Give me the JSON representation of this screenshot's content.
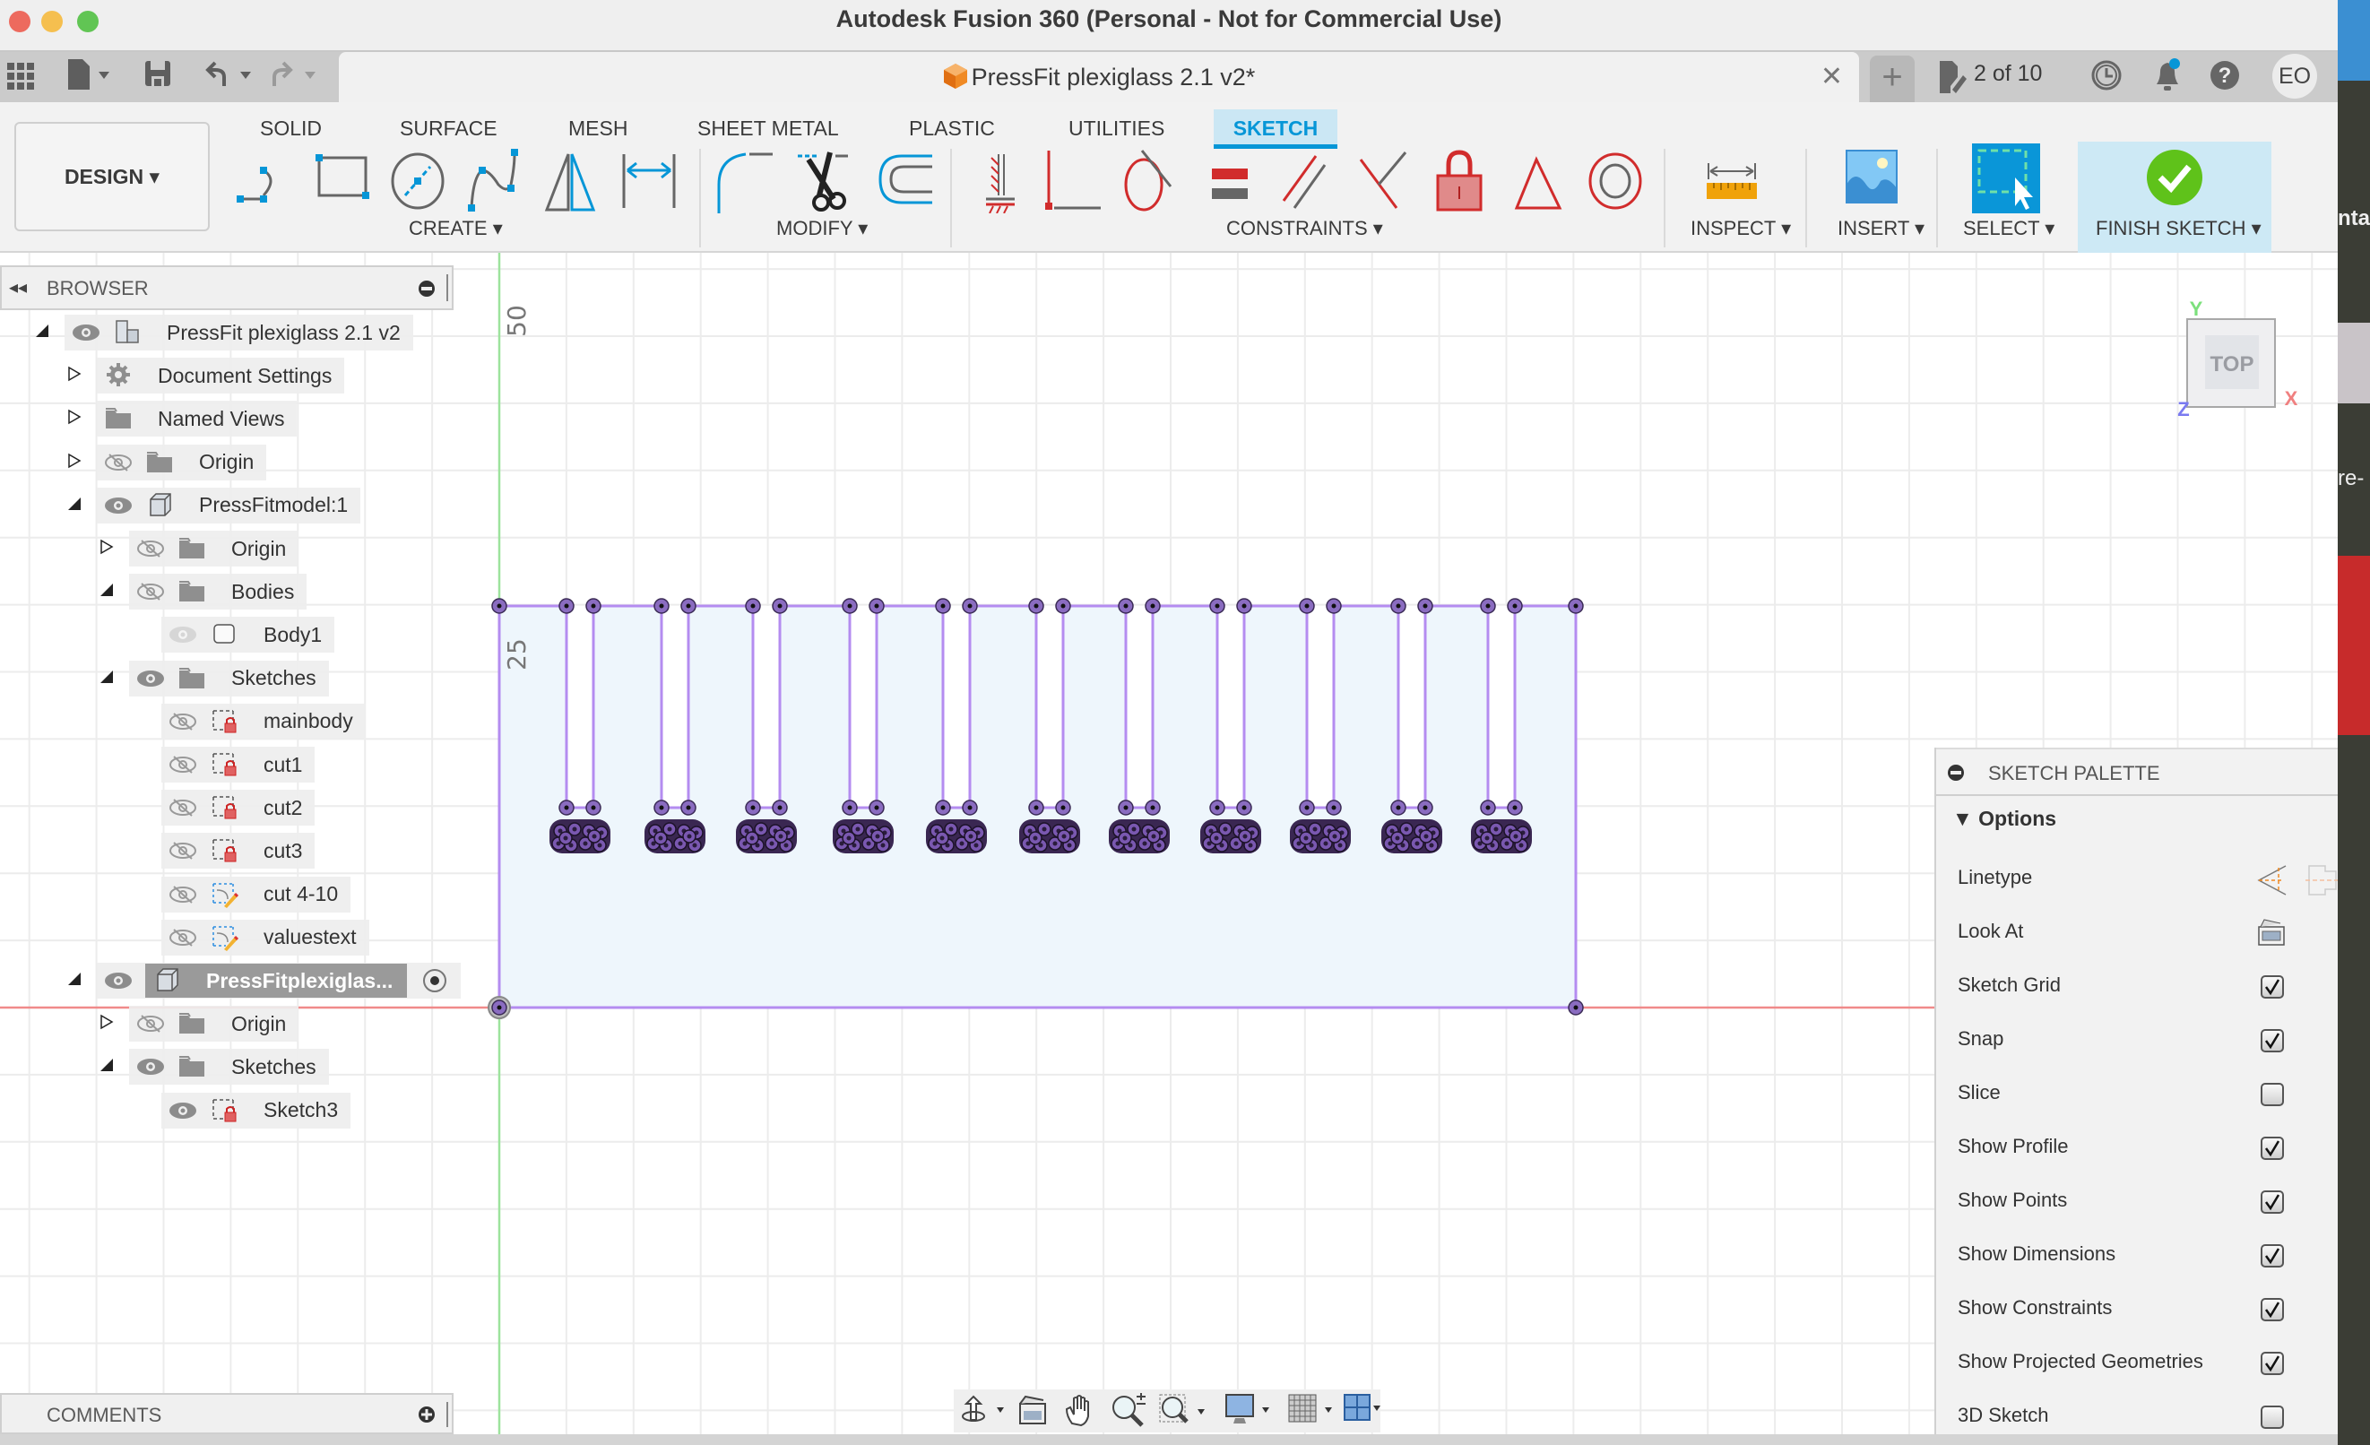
{
  "window": {
    "title": "Autodesk Fusion 360 (Personal - Not for Commercial Use)",
    "traffic_lights": {
      "close": "#ed6a5e",
      "minimize": "#f5bf4f",
      "maximize": "#61c554"
    }
  },
  "tabbar": {
    "quick_access": [
      "apps-grid-icon",
      "file-menu-icon",
      "save-icon",
      "undo-icon",
      "redo-icon"
    ],
    "document_tab": {
      "title": "PressFit plexiglass 2.1 v2*",
      "icon": "design-cube-icon"
    },
    "new_tab_label": "+",
    "job_status": "2 of 10",
    "right_icons": [
      "job-status-icon",
      "history-clock-icon",
      "notifications-bell-icon",
      "help-icon"
    ],
    "user_initials": "EO"
  },
  "ribbon": {
    "workspace": "DESIGN",
    "tabs": [
      {
        "label": "SOLID",
        "active": false
      },
      {
        "label": "SURFACE",
        "active": false
      },
      {
        "label": "MESH",
        "active": false
      },
      {
        "label": "SHEET METAL",
        "active": false
      },
      {
        "label": "PLASTIC",
        "active": false
      },
      {
        "label": "UTILITIES",
        "active": false
      },
      {
        "label": "SKETCH",
        "active": true
      }
    ],
    "groups": {
      "create": {
        "label": "CREATE",
        "tools": [
          "line",
          "rectangle",
          "circle",
          "spline",
          "mirror",
          "sketch-dimension"
        ]
      },
      "modify": {
        "label": "MODIFY",
        "tools": [
          "fillet",
          "trim",
          "offset"
        ]
      },
      "constraints": {
        "label": "CONSTRAINTS",
        "tools": [
          "fix",
          "coincident",
          "tangent",
          "equal",
          "parallel",
          "perpendicular",
          "lock",
          "triangle",
          "concentric"
        ]
      },
      "inspect": {
        "label": "INSPECT"
      },
      "insert": {
        "label": "INSERT"
      },
      "select": {
        "label": "SELECT"
      },
      "finish": {
        "label": "FINISH SKETCH"
      }
    },
    "accent": "#0696d7"
  },
  "browser": {
    "title": "BROWSER",
    "items": [
      {
        "label": "PressFit plexiglass 2.1 v2",
        "depth": 0,
        "expander": "open",
        "eye": "visible",
        "icon": "document-component-icon"
      },
      {
        "label": "Document Settings",
        "depth": 1,
        "expander": "closed",
        "eye": "none",
        "icon": "gear-icon"
      },
      {
        "label": "Named Views",
        "depth": 1,
        "expander": "closed",
        "eye": "none",
        "icon": "folder-icon"
      },
      {
        "label": "Origin",
        "depth": 1,
        "expander": "closed",
        "eye": "hidden",
        "icon": "folder-icon"
      },
      {
        "label": "PressFitmodel:1",
        "depth": 1,
        "expander": "open",
        "eye": "visible",
        "icon": "component-icon"
      },
      {
        "label": "Origin",
        "depth": 2,
        "expander": "closed",
        "eye": "hidden",
        "icon": "folder-icon"
      },
      {
        "label": "Bodies",
        "depth": 2,
        "expander": "open",
        "eye": "hidden",
        "icon": "folder-icon"
      },
      {
        "label": "Body1",
        "depth": 3,
        "expander": "none",
        "eye": "faded",
        "icon": "body-icon"
      },
      {
        "label": "Sketches",
        "depth": 2,
        "expander": "open",
        "eye": "visible",
        "icon": "folder-icon"
      },
      {
        "label": "mainbody",
        "depth": 3,
        "expander": "none",
        "eye": "hidden",
        "icon": "sketch-locked-icon"
      },
      {
        "label": "cut1",
        "depth": 3,
        "expander": "none",
        "eye": "hidden",
        "icon": "sketch-locked-icon"
      },
      {
        "label": "cut2",
        "depth": 3,
        "expander": "none",
        "eye": "hidden",
        "icon": "sketch-locked-icon"
      },
      {
        "label": "cut3",
        "depth": 3,
        "expander": "none",
        "eye": "hidden",
        "icon": "sketch-locked-icon"
      },
      {
        "label": "cut 4-10",
        "depth": 3,
        "expander": "none",
        "eye": "hidden",
        "icon": "sketch-edit-icon"
      },
      {
        "label": "valuestext",
        "depth": 3,
        "expander": "none",
        "eye": "hidden",
        "icon": "sketch-edit-icon"
      },
      {
        "label": "PressFitplexiglas...",
        "depth": 1,
        "expander": "open",
        "eye": "visible",
        "icon": "component-icon",
        "active": true
      },
      {
        "label": "Origin",
        "depth": 2,
        "expander": "closed",
        "eye": "hidden",
        "icon": "folder-icon"
      },
      {
        "label": "Sketches",
        "depth": 2,
        "expander": "open",
        "eye": "visible",
        "icon": "folder-icon"
      },
      {
        "label": "Sketch3",
        "depth": 3,
        "expander": "none",
        "eye": "visible",
        "icon": "sketch-locked-icon"
      }
    ]
  },
  "canvas": {
    "dimension_labels": [
      "50",
      "25"
    ],
    "view_cube": {
      "face": "TOP",
      "axes": {
        "x": "X",
        "y": "Y",
        "z": "Z"
      }
    },
    "sketch": {
      "slot_count": 11,
      "profile_color": "#b48cf0",
      "fill_color": "#eef6fc"
    }
  },
  "sketch_palette": {
    "title": "SKETCH PALETTE",
    "section": "Options",
    "rows": [
      {
        "label": "Linetype",
        "type": "icons"
      },
      {
        "label": "Look At",
        "type": "button"
      },
      {
        "label": "Sketch Grid",
        "type": "checkbox",
        "checked": true
      },
      {
        "label": "Snap",
        "type": "checkbox",
        "checked": true
      },
      {
        "label": "Slice",
        "type": "checkbox",
        "checked": false
      },
      {
        "label": "Show Profile",
        "type": "checkbox",
        "checked": true
      },
      {
        "label": "Show Points",
        "type": "checkbox",
        "checked": true
      },
      {
        "label": "Show Dimensions",
        "type": "checkbox",
        "checked": true
      },
      {
        "label": "Show Constraints",
        "type": "checkbox",
        "checked": true
      },
      {
        "label": "Show Projected Geometries",
        "type": "checkbox",
        "checked": true
      },
      {
        "label": "3D Sketch",
        "type": "checkbox",
        "checked": false
      }
    ]
  },
  "comments": {
    "title": "COMMENTS"
  },
  "navbar": {
    "tools": [
      "orbit-icon",
      "look-at-icon",
      "pan-hand-icon",
      "zoom-icon",
      "zoom-window-icon",
      "display-settings-icon",
      "grid-settings-icon",
      "viewports-icon"
    ]
  }
}
